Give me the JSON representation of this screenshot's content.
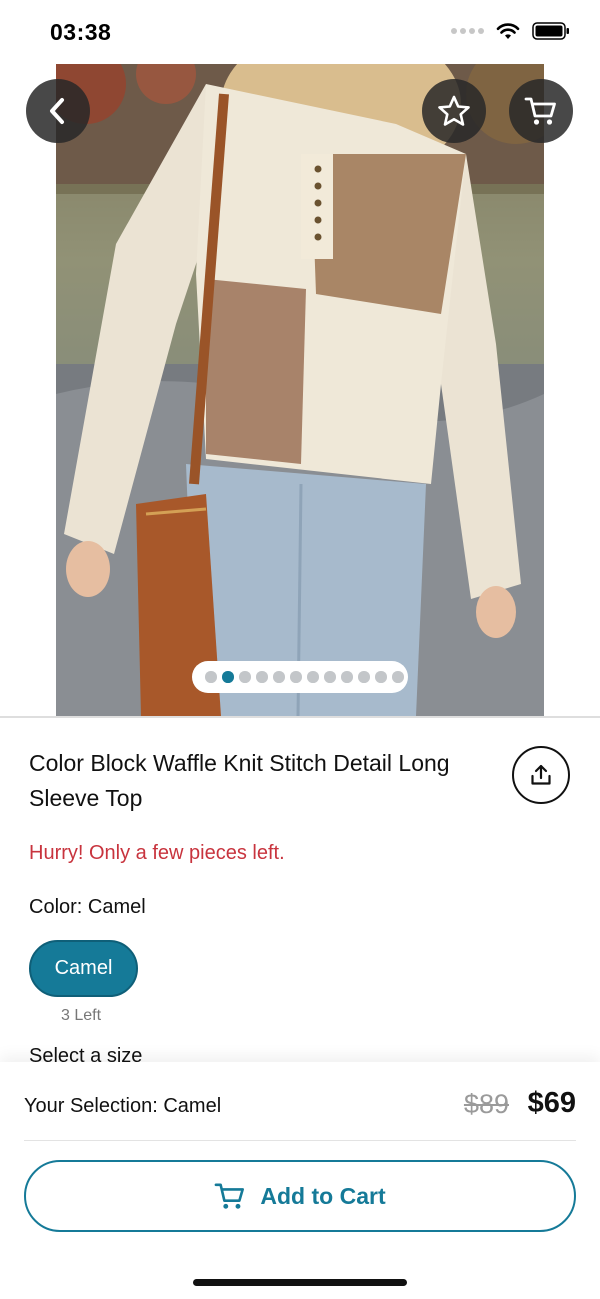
{
  "status_bar": {
    "time": "03:38"
  },
  "nav": {
    "back_icon": "chevron-left-icon",
    "favorite_icon": "star-outline-icon",
    "cart_icon": "shopping-cart-icon"
  },
  "gallery": {
    "page_count": 12,
    "active_page": 2
  },
  "product": {
    "title": "Color Block Waffle Knit Stitch Detail Long Sleeve Top",
    "stock_warning": "Hurry! Only a few pieces left.",
    "color_label": "Color: Camel",
    "color_option": {
      "label": "Camel",
      "stock": "3 Left",
      "selected": true
    },
    "size_label": "Select a size"
  },
  "checkout": {
    "selection": "Your Selection: Camel",
    "original_price": "$89",
    "sale_price": "$69",
    "add_to_cart_label": "Add to Cart"
  },
  "colors": {
    "accent": "#157a98",
    "warning": "#c8343e"
  }
}
